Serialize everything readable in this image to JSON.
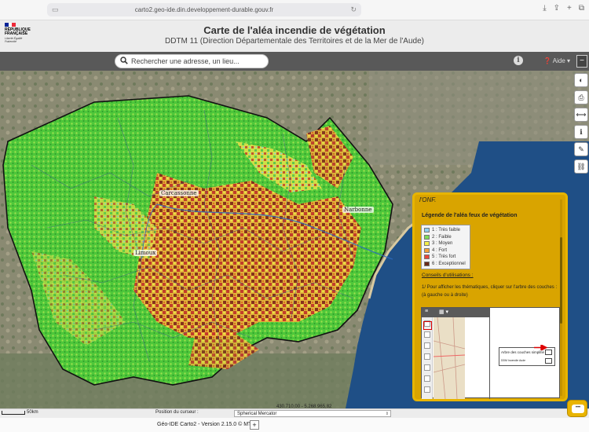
{
  "browser": {
    "url": "carto2.geo-ide.din.developpement-durable.gouv.fr"
  },
  "header": {
    "logo_text": "RÉPUBLIQUE\nFRANÇAISE",
    "motto": "Liberté Égalité Fraternité",
    "title": "Carte de l'aléa incendie de végétation",
    "subtitle": "DDTM 11 (Direction Départementale des Territoires et de la Mer de l'Aude)"
  },
  "toolbar": {
    "search_placeholder": "Rechercher une adresse, un lieu...",
    "help_label": "Aide",
    "info_icon": "info-icon",
    "menu_icon": "minus-icon"
  },
  "map": {
    "cities": [
      {
        "name": "Carcassonne"
      },
      {
        "name": "Narbonne"
      },
      {
        "name": "Limoux"
      }
    ]
  },
  "tools": [
    "layers-icon",
    "print-icon",
    "measure-icon",
    "info-icon",
    "draw-icon",
    "link-icon"
  ],
  "legend_panel": {
    "top_note": "l'ONF.",
    "heading": "Légende de l'aléa feux de végétation",
    "classes": [
      {
        "label": "1 : Très faible",
        "color": "#8fd0f0"
      },
      {
        "label": "2 : Faible",
        "color": "#7ddc5a"
      },
      {
        "label": "3 : Moyen",
        "color": "#f4ef4a"
      },
      {
        "label": "4 : Fort",
        "color": "#f4a13a"
      },
      {
        "label": "5 : Très fort",
        "color": "#e8463a"
      },
      {
        "label": "6 : Exceptionnel",
        "color": "#6a2a1a"
      }
    ],
    "advice_title": "Conseils d'utilisations :",
    "advice_text": "1/ Pour afficher les thématiques, cliquer sur l'arbre des couches :",
    "advice_text2": "(à gauche ou à droite)",
    "screenshot": {
      "tree_label": "Arbre des couches simplifié",
      "layer_label": "DDM Incendie Aude"
    }
  },
  "status": {
    "scale_label": "50km",
    "cursor_label": "Position du curseur :",
    "projection": "Spherical Mercator",
    "coordinates": "430.710,00 - 5.268.965,82"
  },
  "footer": {
    "version": "Géo-IDE Carto2 - Version 2.15.0 © MTES",
    "plus": "+"
  },
  "colors": {
    "accent": "#e7b400",
    "toolbar": "#595959",
    "sea": "#1f4f86"
  }
}
